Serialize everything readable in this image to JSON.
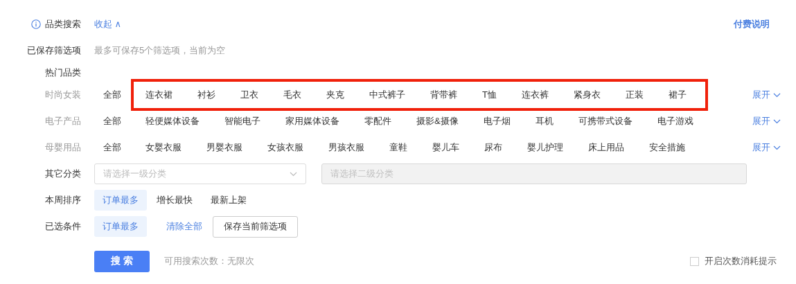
{
  "header": {
    "title": "品类搜索",
    "collapse_link": "收起 ∧",
    "fee_link": "付费说明"
  },
  "saved": {
    "label": "已保存筛选项",
    "note": "最多可保存5个筛选项，当前为空"
  },
  "hot": {
    "label": "热门品类"
  },
  "categories": [
    {
      "label": "时尚女装",
      "highlighted": true,
      "items": [
        "全部",
        "连衣裙",
        "衬衫",
        "卫衣",
        "毛衣",
        "夹克",
        "中式裤子",
        "背带裤",
        "T恤",
        "连衣裤",
        "紧身衣",
        "正装",
        "裙子"
      ],
      "expand": "展开"
    },
    {
      "label": "电子产品",
      "highlighted": false,
      "items": [
        "全部",
        "轻便媒体设备",
        "智能电子",
        "家用媒体设备",
        "零配件",
        "摄影&摄像",
        "电子烟",
        "耳机",
        "可携带式设备",
        "电子游戏"
      ],
      "expand": "展开"
    },
    {
      "label": "母婴用品",
      "highlighted": false,
      "items": [
        "全部",
        "女婴衣服",
        "男婴衣服",
        "女孩衣服",
        "男孩衣服",
        "童鞋",
        "婴儿车",
        "尿布",
        "婴儿护理",
        "床上用品",
        "安全措施"
      ],
      "expand": "展开"
    }
  ],
  "other": {
    "label": "其它分类",
    "level1": {
      "placeholder": "请选择一级分类"
    },
    "level2": {
      "placeholder": "请选择二级分类",
      "disabled": true
    }
  },
  "sort": {
    "label": "本周排序",
    "options": [
      {
        "label": "订单最多",
        "selected": true
      },
      {
        "label": "增长最快",
        "selected": false
      },
      {
        "label": "最新上架",
        "selected": false
      }
    ]
  },
  "chosen": {
    "label": "已选条件",
    "tags": [
      "订单最多"
    ],
    "clear": "清除全部",
    "save": "保存当前筛选项"
  },
  "search": {
    "button": "搜 索",
    "remaining": "可用搜索次数：无限次",
    "reminder": {
      "label": "开启次数消耗提示",
      "checked": false
    }
  }
}
